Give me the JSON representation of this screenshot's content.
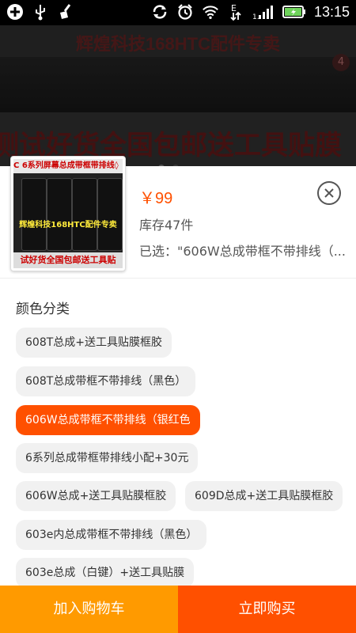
{
  "status_bar": {
    "time": "13:15",
    "icons_left": [
      "add-circle-icon",
      "usb-icon",
      "broom-icon"
    ],
    "icons_right": [
      "sync-icon",
      "alarm-icon",
      "wifi-icon",
      "data-arrows-icon",
      "signal-icon",
      "battery-icon"
    ],
    "signal_label": "1."
  },
  "banner": {
    "top_text": "辉煌科技168HTC配件专卖",
    "bottom_text": "测试好货全国包邮送工具贴膜",
    "badge": "4",
    "dot_count": 2
  },
  "product": {
    "thumb_top_text": "C 6系列屏幕总成带框带排线◊",
    "thumb_mid_text": "辉煌科技168HTC配件专卖",
    "thumb_bottom_text": "试好货全国包邮送工具贴",
    "price": "￥99",
    "stock": "库存47件",
    "selected": "已选：\"606W总成带框不带排线（..."
  },
  "variants": {
    "title": "颜色分类",
    "options": [
      {
        "label": "608T总成+送工具贴膜框胶"
      },
      {
        "label": "608T总成带框不带排线（黑色）"
      },
      {
        "label": "606W总成带框不带排线（银红色",
        "selected": true
      },
      {
        "label": "6系列总成带框带排线小配+30元"
      },
      {
        "label": "606W总成+送工具贴膜框胶"
      },
      {
        "label": "609D总成+送工具贴膜框胶"
      },
      {
        "label": "603e内总成带框不带排线（黑色）"
      },
      {
        "label": "603e总成（白键）+送工具贴膜"
      }
    ]
  },
  "actions": {
    "add_to_cart": "加入购物车",
    "buy_now": "立即购买"
  },
  "colors": {
    "accent": "#ff5000",
    "cart": "#ff9a00"
  }
}
